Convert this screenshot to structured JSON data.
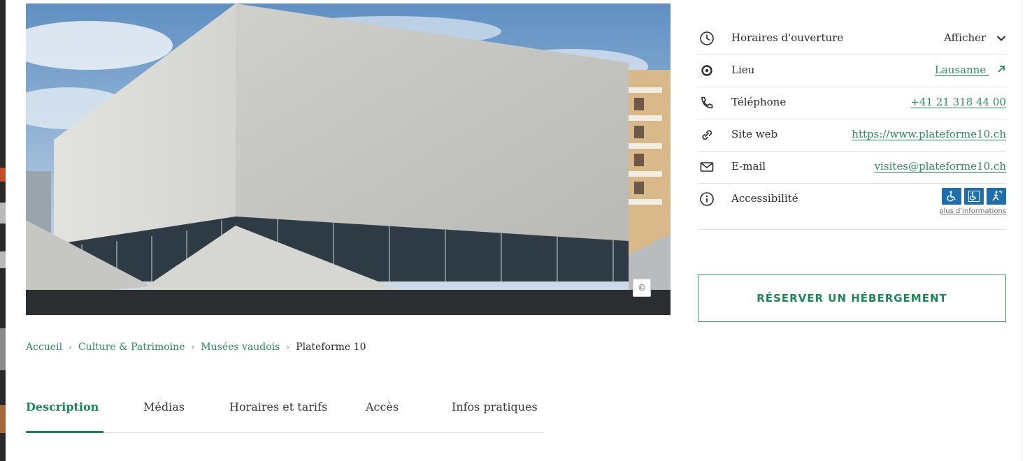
{
  "hero": {
    "copyright_symbol": "©"
  },
  "breadcrumb": {
    "items": [
      "Accueil",
      "Culture & Patrimoine",
      "Musées vaudois"
    ],
    "current": "Plateforme 10",
    "separator": "›"
  },
  "tabs": [
    {
      "label": "Description",
      "active": true
    },
    {
      "label": "Médias",
      "active": false
    },
    {
      "label": "Horaires et tarifs",
      "active": false
    },
    {
      "label": "Accès",
      "active": false
    },
    {
      "label": "Infos pratiques",
      "active": false
    }
  ],
  "info": {
    "hours": {
      "label": "Horaires d'ouverture",
      "value": "Afficher",
      "icon": "clock-icon"
    },
    "location": {
      "label": "Lieu",
      "value": "Lausanne",
      "icon": "location-pin-icon"
    },
    "phone": {
      "label": "Téléphone",
      "value": "+41 21 318 44 00",
      "icon": "phone-icon"
    },
    "website": {
      "label": "Site web",
      "value": "https://www.plateforme10.ch",
      "icon": "link-icon"
    },
    "email": {
      "label": "E-mail",
      "value": "visites@plateforme10.ch",
      "icon": "mail-icon"
    },
    "accessibility": {
      "label": "Accessibilité",
      "more": "plus d'informations",
      "icon": "info-icon",
      "badges": [
        "wheelchair-icon",
        "wheelchair-wc-icon",
        "reduced-mobility-icon"
      ]
    }
  },
  "booking": {
    "label": "RÉSERVER UN HÉBERGEMENT"
  },
  "colors": {
    "accent_green": "#1e8656",
    "link_green": "#2e8a5e",
    "accessibility_blue": "#1f6fae",
    "divider": "#dde3df"
  }
}
